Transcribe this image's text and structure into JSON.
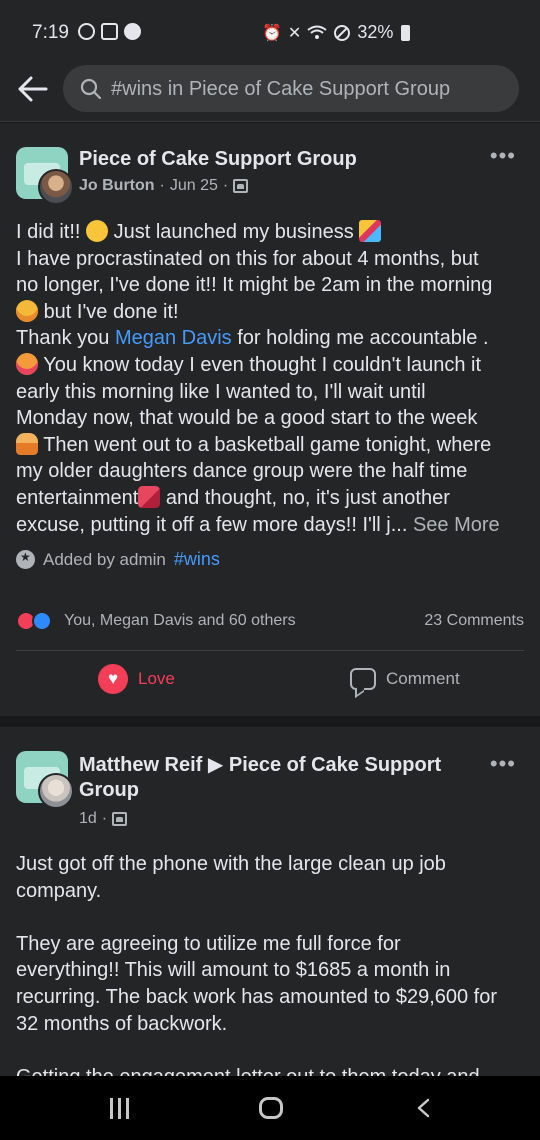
{
  "status_bar": {
    "time": "7:19",
    "battery": "32%"
  },
  "search": {
    "value": "#wins in Piece of Cake Support Group"
  },
  "posts": [
    {
      "title": "Piece of Cake Support Group",
      "author": "Jo Burton",
      "date": "Jun 25",
      "body": {
        "l1": "I did it!!",
        "l1b": "Just launched my business",
        "l2": "I have procrastinated on this for about 4 months, but",
        "l3": "no longer, I've done it!!  It might be 2am in the morning",
        "l4": "but I've done it!",
        "l5a": "Thank you",
        "l5m": "Megan Davis",
        "l5b": "for holding me accountable .",
        "l6": "You know today I even thought I couldn't launch it",
        "l7": "early this morning like I wanted to, I'll wait until",
        "l8": "Monday now, that would be a good start to the week",
        "l9": "Then went out to a basketball game tonight, where",
        "l10": "my older daughters dance group were the half time",
        "l11a": "entertainment",
        "l11b": "and thought, no, it's just another",
        "l12": "excuse, putting it off a few more days!! I'll j...",
        "see_more": "See More"
      },
      "added_by": "Added by admin",
      "hashtag": "#wins",
      "reactions_text": "You, Megan Davis and 60 others",
      "comments_text": "23 Comments",
      "love_label": "Love",
      "comment_label": "Comment"
    },
    {
      "author": "Matthew Reif",
      "arrow": "▶",
      "title": "Piece of Cake Support",
      "title2": "Group",
      "date": "1d",
      "body": {
        "p1a": "Just got off the phone with the large clean up job",
        "p1b": "company.",
        "p2a": "They are agreeing to utilize me full force for",
        "p2b": "everything!! This will amount to $1685 a month in",
        "p2c": "recurring. The back work has amounted to $29,600 for",
        "p2d": "32 months of backwork.",
        "p3a": "Getting the engagement letter out to them today and"
      }
    }
  ],
  "icons": {
    "back": "arrow-left-icon",
    "search": "search-icon",
    "more": "more-dots-icon"
  },
  "colors": {
    "background": "#18191a",
    "card": "#242526",
    "mention": "#4599ff",
    "love": "#f33e58"
  }
}
